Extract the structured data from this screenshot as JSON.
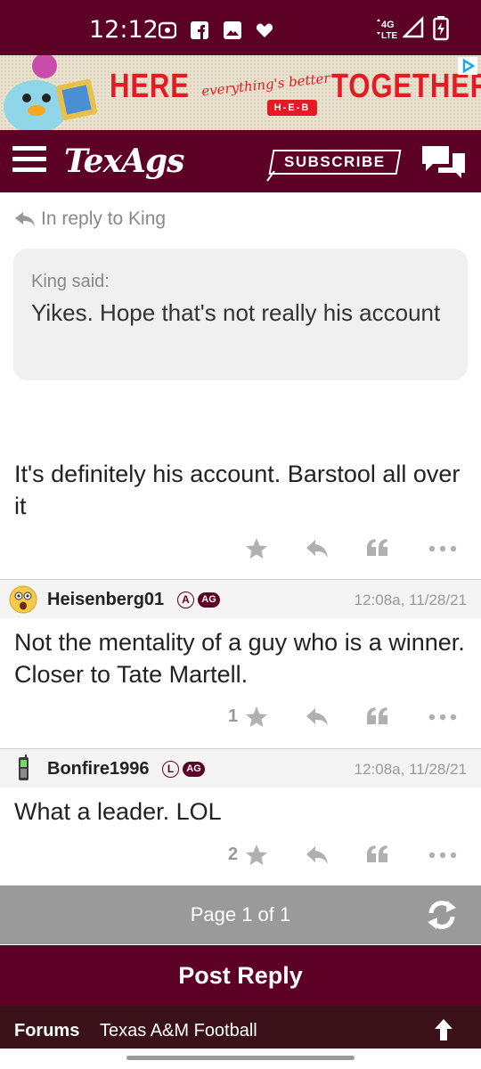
{
  "status_bar": {
    "time": "12:12",
    "network": "4G LTE"
  },
  "ad": {
    "headline_left": "HERE",
    "tagline": "everything's better",
    "headline_right": "TOGETHER",
    "brand": "H-E-B"
  },
  "header": {
    "logo": "TexAgs",
    "subscribe_label": "SUBSCRIBE"
  },
  "thread": {
    "reply_to": "In reply to King",
    "quote": {
      "author": "King said:",
      "text": "Yikes. Hope that's not really his account"
    },
    "first_post_text": "It's definitely his account. Barstool all over it"
  },
  "posts": [
    {
      "username": "Heisenberg01",
      "badge_letter": "A",
      "badge_ag": "AG",
      "timestamp": "12:08a, 11/28/21",
      "text": "Not the mentality of a guy who is a winner. Closer to Tate Martell.",
      "star_count": "1"
    },
    {
      "username": "Bonfire1996",
      "badge_letter": "L",
      "badge_ag": "AG",
      "timestamp": "12:08a, 11/28/21",
      "text": "What a leader. LOL",
      "star_count": "2"
    }
  ],
  "pagination": {
    "label": "Page 1 of 1"
  },
  "post_reply_label": "Post Reply",
  "footer": {
    "forums_label": "Forums",
    "breadcrumb": "Texas A&M Football"
  },
  "colors": {
    "brand_maroon": "#5d0025",
    "pagination_gray": "#9a9a9a",
    "icon_gray": "#b0b0b0"
  }
}
